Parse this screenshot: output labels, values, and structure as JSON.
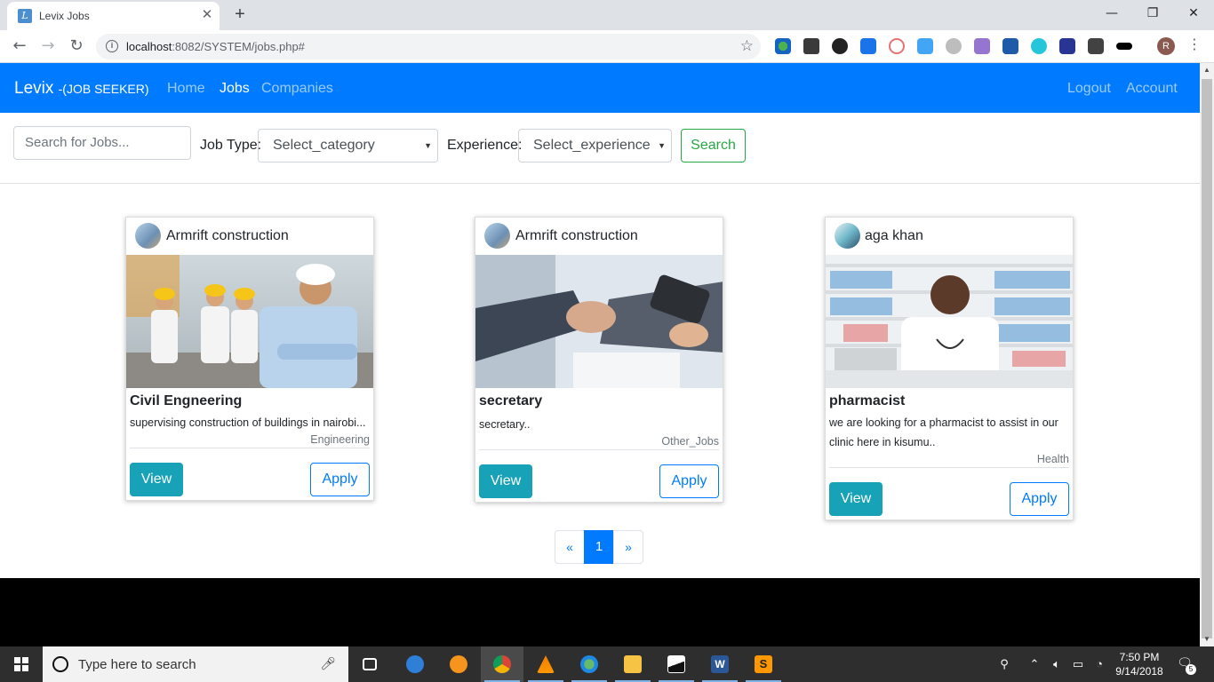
{
  "browser": {
    "tab_title": "Levix Jobs",
    "url_host": "localhost",
    "url_rest": ":8082/SYSTEM/jobs.php#",
    "profile_initial": "R"
  },
  "navbar": {
    "brand": "Levix",
    "brand_sub": "-(JOB SEEKER)",
    "links": [
      "Home",
      "Jobs",
      "Companies"
    ],
    "right_links": [
      "Logout",
      "Account"
    ],
    "active": "Jobs",
    "color": "#007bff"
  },
  "search": {
    "placeholder": "Search for Jobs...",
    "job_type_label": "Job Type:",
    "job_type_value": "Select_category",
    "experience_label": "Experience:",
    "experience_value": "Select_experience",
    "button": "Search"
  },
  "jobs": [
    {
      "company": "Armrift construction",
      "title": "Civil Engneering",
      "description": "supervising construction of buildings in nairobi...",
      "category": "Engineering",
      "view": "View",
      "apply": "Apply"
    },
    {
      "company": "Armrift construction",
      "title": "secretary",
      "description": "secretary..",
      "category": "Other_Jobs",
      "view": "View",
      "apply": "Apply"
    },
    {
      "company": "aga khan",
      "title": "pharmacist",
      "description": "we are looking for a pharmacist to assist in our clinic here in kisumu..",
      "category": "Health",
      "view": "View",
      "apply": "Apply"
    }
  ],
  "pagination": {
    "prev": "«",
    "current": "1",
    "next": "»"
  },
  "taskbar": {
    "search_placeholder": "Type here to search",
    "time": "7:50 PM",
    "date": "9/14/2018",
    "notifications": "5"
  }
}
